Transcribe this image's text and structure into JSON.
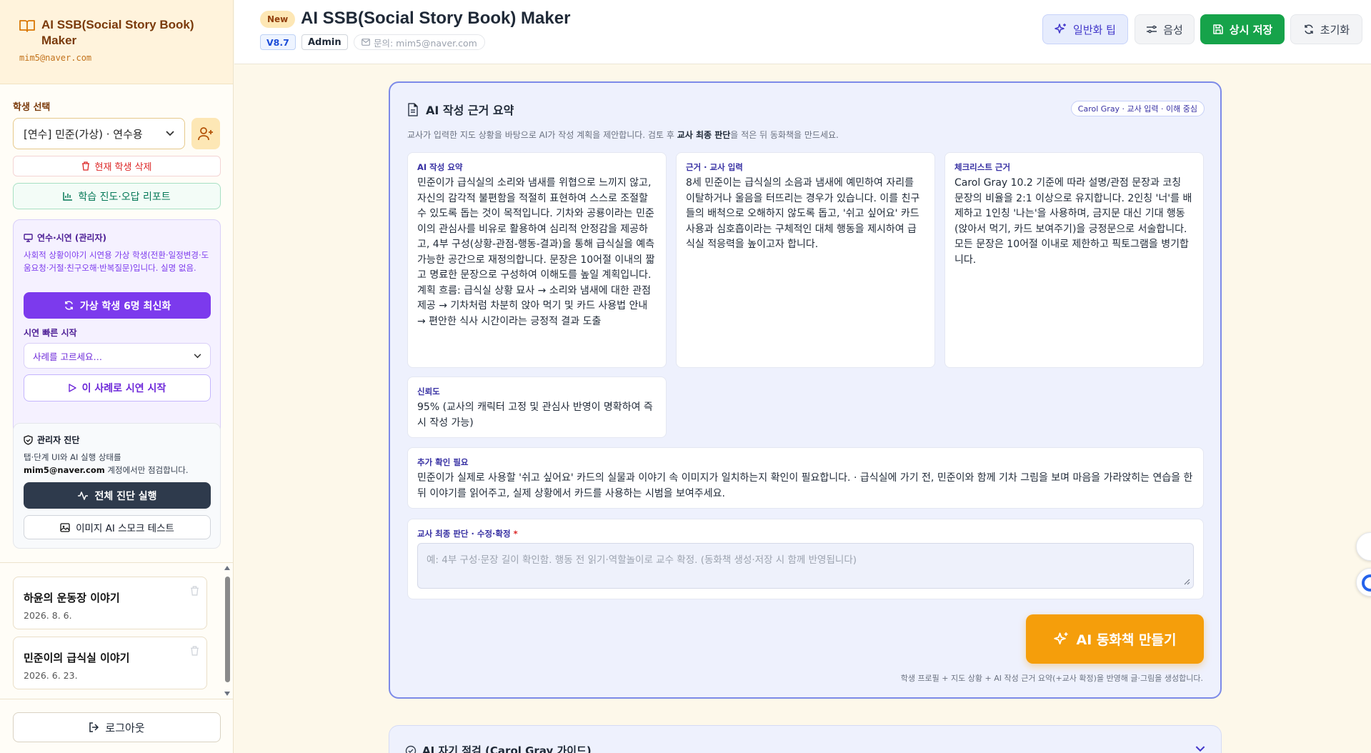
{
  "brand": {
    "title": "AI SSB(Social Story Book) Maker",
    "email": "mim5@naver.com"
  },
  "sidebar": {
    "student_label": "학생 선택",
    "student_selected": "[연수] 민준(가상) · 연수용",
    "delete_student": "현재 학생 삭제",
    "report": "학습 진도·오답 리포트",
    "demo": {
      "title": "연수·시연 (관리자)",
      "desc": "사회적 상황이야기 시연용 가상 학생(전환·일정변경·도움요청·거절·친구오해·반복질문)입니다. 실명 없음.",
      "refresh": "가상 학생 6명 최신화",
      "quick_label": "시연 빠른 시작",
      "case_placeholder": "사례를 고르세요…",
      "start": "이 사례로 시연 시작"
    },
    "admin": {
      "title": "관리자 진단",
      "desc_1": "탭·단계 UI와 AI 실행 상태를",
      "desc_email": "mim5@naver.com",
      "desc_2": " 계정에서만 점검합니다.",
      "run_all": "전체 진단 실행",
      "smoke": "이미지 AI 스모크 테스트"
    },
    "stories": [
      {
        "title": "하윤의 운동장 이야기",
        "date": "2026. 8. 6."
      },
      {
        "title": "민준이의 급식실 이야기",
        "date": "2026. 6. 23."
      }
    ],
    "logout": "로그아웃"
  },
  "header": {
    "new_badge": "New",
    "title": "AI SSB(Social Story Book) Maker",
    "version": "V8.7",
    "role": "Admin",
    "contact": "문의: mim5@naver.com",
    "buttons": {
      "tip": "일반화 팁",
      "voice": "음성",
      "save": "상시 저장",
      "reset": "초기화"
    }
  },
  "summary": {
    "title": "AI 작성 근거 요약",
    "chip": "Carol Gray · 교사 입력 · 이해 중심",
    "desc_1": "교사가 입력한 지도 상황을 바탕으로 AI가 작성 계획을 제안합니다. 검토 후 ",
    "desc_bold": "교사 최종 판단",
    "desc_2": "을 적은 뒤 동화책을 만드세요.",
    "cards": {
      "summary": {
        "label": "AI 작성 요약",
        "text": "민준이가 급식실의 소리와 냄새를 위협으로 느끼지 않고, 자신의 감각적 불편함을 적절히 표현하여 스스로 조절할 수 있도록 돕는 것이 목적입니다. 기차와 공룡이라는 민준이의 관심사를 비유로 활용하여 심리적 안정감을 제공하고, 4부 구성(상황-관점-행동-결과)을 통해 급식실을 예측 가능한 공간으로 재정의합니다. 문장은 10어절 이내의 짧고 명료한 문장으로 구성하여 이해도를 높일 계획입니다.\n계획 흐름: 급식실 상황 묘사 → 소리와 냄새에 대한 관점 제공 → 기차처럼 차분히 앉아 먹기 및 카드 사용법 안내 → 편안한 식사 시간이라는 긍정적 결과 도출"
      },
      "basis": {
        "label": "근거 · 교사 입력",
        "text": "8세 민준이는 급식실의 소음과 냄새에 예민하여 자리를 이탈하거나 울음을 터뜨리는 경우가 있습니다. 이를 친구들의 배척으로 오해하지 않도록 돕고, '쉬고 싶어요' 카드 사용과 심호흡이라는 구체적인 대체 행동을 제시하여 급식실 적응력을 높이고자 합니다."
      },
      "checklist": {
        "label": "체크리스트 근거",
        "text": "Carol Gray 10.2 기준에 따라 설명/관점 문장과 코칭 문장의 비율을 2:1 이상으로 유지합니다. 2인칭 '너'를 배제하고 1인칭 '나는'을 사용하며, 금지문 대신 기대 행동(앉아서 먹기, 카드 보여주기)을 긍정문으로 서술합니다. 모든 문장은 10어절 이내로 제한하고 픽토그램을 병기합니다."
      },
      "confidence": {
        "label": "신뢰도",
        "text": "95% (교사의 캐릭터 고정 및 관심사 반영이 명확하여 즉시 작성 가능)"
      },
      "extra": {
        "label": "추가 확인 필요",
        "text": "민준이가 실제로 사용할 '쉬고 싶어요' 카드의 실물과 이야기 속 이미지가 일치하는지 확인이 필요합니다. · 급식실에 가기 전, 민준이와 함께 기차 그림을 보며 마음을 가라앉히는 연습을 한 뒤 이야기를 읽어주고, 실제 상황에서 카드를 사용하는 시범을 보여주세요."
      },
      "final": {
        "label": "교사 최종 판단 · 수정·확정",
        "required_mark": "*",
        "placeholder": "예: 4부 구성·문장 길이 확인함. 행동 전 읽기·역할놀이로 교수 확정. (동화책 생성·저장 시 함께 반영됩니다)"
      }
    },
    "make_button": "AI 동화책 만들기",
    "footnote": "학생 프로필 + 지도 상황 + AI 작성 근거 요약(+교사 확정)을 반영해 글·그림을 생성합니다."
  },
  "next_panel": {
    "title": "AI 자기 점검 (Carol Gray 가이드)"
  },
  "colors": {
    "accent_orange": "#f59e0b",
    "save_green": "#16a34a",
    "demo_purple": "#7c3aed",
    "panel_border": "#7c8ae8"
  }
}
